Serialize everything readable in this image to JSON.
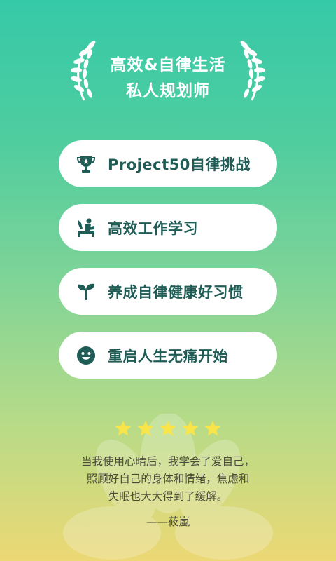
{
  "header": {
    "title_line1": "高效&自律生活",
    "title_line2": "私人规划师"
  },
  "options": [
    {
      "label": "Project50自律挑战",
      "icon": "trophy-icon"
    },
    {
      "label": "高效工作学习",
      "icon": "study-desk-icon"
    },
    {
      "label": "养成自律健康好习惯",
      "icon": "sprout-icon"
    },
    {
      "label": "重启人生无痛开始",
      "icon": "smile-icon"
    }
  ],
  "rating": {
    "stars": 5,
    "color": "#f9e54a"
  },
  "testimonial": {
    "line1": "当我使用心晴后，我学会了爱自己，",
    "line2": "照顾好自己的身体和情绪，焦虑和",
    "line3": "失眠也大大得到了缓解。",
    "author": "——莜嵐"
  },
  "colors": {
    "accent_text": "#1f5c55",
    "gradient_top": "#36c9a8",
    "gradient_bottom": "#ecd874"
  }
}
